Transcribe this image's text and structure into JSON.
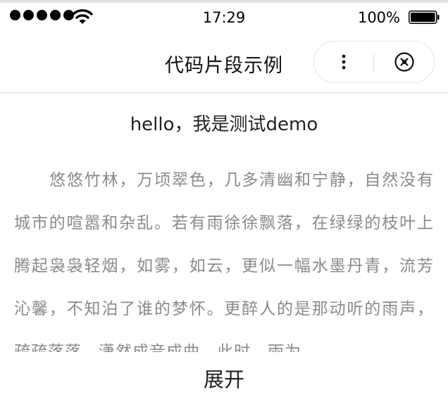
{
  "status_bar": {
    "time": "17:29",
    "battery": "100%"
  },
  "nav": {
    "title": "代码片段示例"
  },
  "content": {
    "title": "hello，我是测试demo",
    "paragraph": "悠悠竹林，万顷翠色，几多清幽和宁静，自然没有城市的喧嚣和杂乱。若有雨徐徐飘落，在绿绿的枝叶上腾起袅袅轻烟，如雾，如云，更似一幅水墨丹青，流芳沁馨，不知泊了谁的梦怀。更醉人的是那动听的雨声，疏疏落落，潇然成音成曲。此时，雨为…",
    "expand_label": "展开"
  },
  "icons": {
    "wifi": "wifi-icon",
    "battery": "battery-icon",
    "more": "more-dots-icon",
    "close": "close-circle-icon"
  }
}
